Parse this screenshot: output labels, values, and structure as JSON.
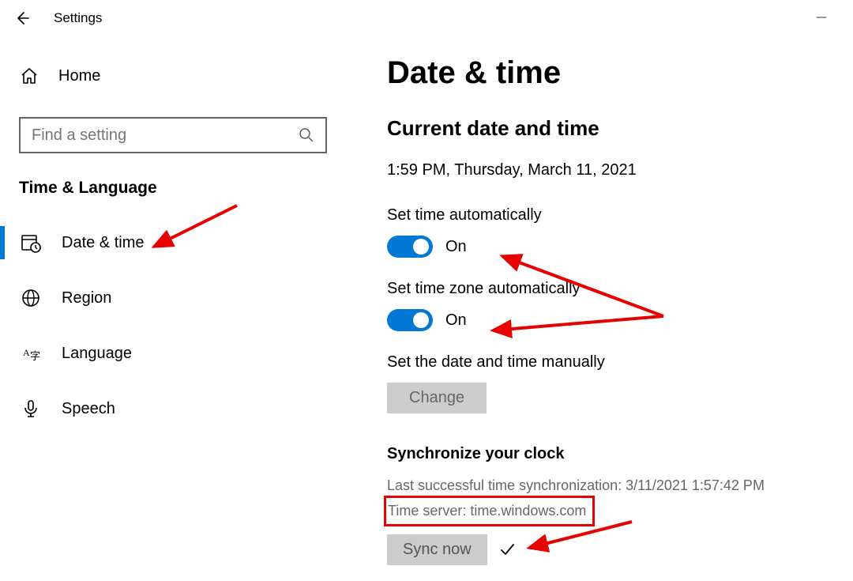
{
  "titlebar": {
    "title": "Settings"
  },
  "sidebar": {
    "home_label": "Home",
    "search_placeholder": "Find a setting",
    "category_label": "Time & Language",
    "items": [
      {
        "label": "Date & time",
        "selected": true
      },
      {
        "label": "Region",
        "selected": false
      },
      {
        "label": "Language",
        "selected": false
      },
      {
        "label": "Speech",
        "selected": false
      }
    ]
  },
  "main": {
    "page_title": "Date & time",
    "current_section": "Current date and time",
    "current_value": "1:59 PM, Thursday, March 11, 2021",
    "set_time_auto_label": "Set time automatically",
    "set_time_auto_state": "On",
    "set_tz_auto_label": "Set time zone automatically",
    "set_tz_auto_state": "On",
    "manual_label": "Set the date and time manually",
    "change_button": "Change",
    "sync_section": "Synchronize your clock",
    "last_sync_text": "Last successful time synchronization: 3/11/2021 1:57:42 PM",
    "time_server_text": "Time server: time.windows.com",
    "sync_button": "Sync now"
  }
}
